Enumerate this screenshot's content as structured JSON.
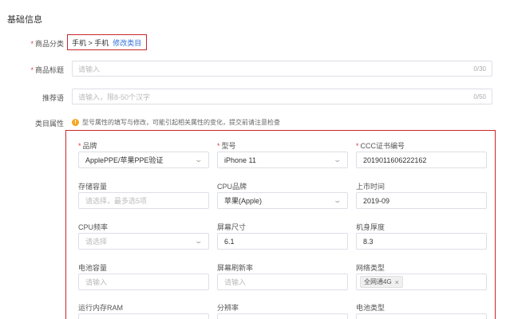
{
  "section": {
    "title": "基础信息"
  },
  "category": {
    "label": "商品分类",
    "value": "手机 > 手机",
    "edit_link": "修改类目"
  },
  "product_title": {
    "label": "商品标题",
    "placeholder": "请输入",
    "counter": "0/30"
  },
  "recommend": {
    "label": "推荐语",
    "placeholder": "请输入，限8-50个汉字",
    "counter": "0/50"
  },
  "attributes": {
    "label": "类目属性",
    "notice": "型号属性的填写与修改，可能引起相关属性的变化，提交前请注意检查",
    "fields": {
      "brand": {
        "label": "品牌",
        "value": "ApplePPE/苹果PPE验证"
      },
      "model": {
        "label": "型号",
        "value": "iPhone 11"
      },
      "ccc": {
        "label": "CCC证书编号",
        "value": "2019011606222162"
      },
      "storage": {
        "label": "存储容量",
        "placeholder": "请选择，最多选5项"
      },
      "cpu_brand": {
        "label": "CPU品牌",
        "value": "苹果(Apple)"
      },
      "launch": {
        "label": "上市时间",
        "value": "2019-09"
      },
      "cpu_freq": {
        "label": "CPU频率",
        "placeholder": "请选择"
      },
      "screen_size": {
        "label": "屏幕尺寸",
        "value": "6.1"
      },
      "thickness": {
        "label": "机身厚度",
        "value": "8.3"
      },
      "battery": {
        "label": "电池容量",
        "placeholder": "请输入"
      },
      "refresh": {
        "label": "屏幕刷新率",
        "placeholder": "请输入"
      },
      "network": {
        "label": "网络类型",
        "tag": "全网通4G"
      },
      "ram": {
        "label": "运行内存RAM"
      },
      "resolution": {
        "label": "分辨率"
      },
      "battery_type": {
        "label": "电池类型"
      }
    }
  },
  "icons": {
    "chevron": "chevron-down-icon",
    "warning": "warning-icon",
    "close": "close-icon"
  },
  "colors": {
    "required": "#e4393c",
    "highlight_border": "#c9262b",
    "link": "#2f6fd6",
    "warning": "#f5a623"
  }
}
